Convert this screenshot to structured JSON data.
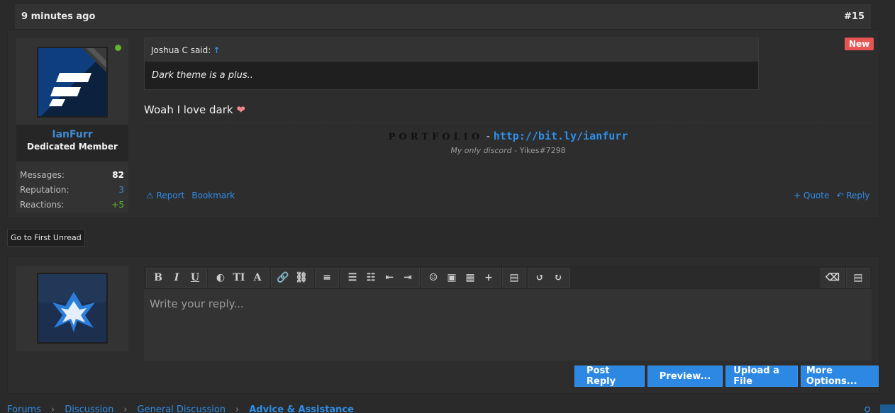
{
  "post": {
    "time": "9 minutes ago",
    "number": "#15",
    "new_badge": "New",
    "author": {
      "name": "IanFurr",
      "title": "Dedicated Member",
      "stats": [
        {
          "label": "Messages:",
          "value": "82",
          "color": "#ffffff"
        },
        {
          "label": "Reputation:",
          "value": "3",
          "color": "#3f8bd6"
        },
        {
          "label": "Reactions:",
          "value": "+5",
          "color": "#63b32e"
        }
      ]
    },
    "quote": {
      "header": "Joshua C said:",
      "arrow": "↑",
      "text": "Dark theme is a plus.."
    },
    "message": "Woah I love dark",
    "heart": "❤",
    "signature": {
      "portfolio": "PORTFOLIO",
      "dash": " - ",
      "link": "http://bit.ly/ianfurr",
      "line2_italic": "My only discord",
      "line2_rest": " - Yikes#7298"
    },
    "actions_left": [
      {
        "icon": "⚠",
        "label": "Report"
      },
      {
        "label": "Bookmark"
      }
    ],
    "actions_right": [
      {
        "label": "+ Quote"
      },
      {
        "icon": "↶",
        "label": "Reply"
      }
    ]
  },
  "first_unread": "Go to First Unread",
  "editor": {
    "placeholder": "Write your reply...",
    "buttons": {
      "post_reply": "Post Reply",
      "preview": "Preview...",
      "upload": "Upload a File",
      "more": "More Options..."
    }
  },
  "breadcrumb": [
    "Forums",
    "Discussion",
    "General Discussion",
    "Advice & Assistance"
  ],
  "colors": {
    "accent": "#2d88e4",
    "badge": "#e85454",
    "online": "#63b32e"
  }
}
